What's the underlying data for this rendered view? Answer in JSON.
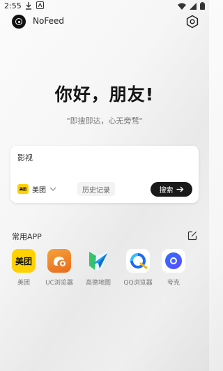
{
  "status_bar": {
    "time": "2:55",
    "icons": [
      "download-icon",
      "accessibility-icon",
      "wifi-icon",
      "signal-icon",
      "battery-icon"
    ]
  },
  "app_bar": {
    "title": "NoFeed",
    "icons": [
      "nofeed-logo-icon",
      "settings-hex-icon"
    ]
  },
  "hero": {
    "greeting": "你好，朋友!",
    "slogan": "\"即搜即达，心无旁骛\""
  },
  "search": {
    "value": "影视",
    "engine": {
      "name": "美团",
      "logo_text": "美团"
    },
    "history_label": "历史记录",
    "button_label": "搜索"
  },
  "apps": {
    "title": "常用APP",
    "items": [
      {
        "label": "美团",
        "icon": "meituan-icon",
        "logo_text": "美团",
        "color": "#ffd100"
      },
      {
        "label": "UC浏览器",
        "icon": "uc-browser-icon",
        "color": "#f08a24"
      },
      {
        "label": "高德地图",
        "icon": "amap-icon",
        "color": "#1e9df0"
      },
      {
        "label": "QQ浏览器",
        "icon": "qq-browser-icon",
        "color": "#1a6bf5"
      },
      {
        "label": "夸克",
        "icon": "quark-icon",
        "color": "#2f6dff"
      }
    ]
  },
  "colors": {
    "search_button": "#1a1a1a",
    "meituan_yellow": "#ffd100"
  }
}
